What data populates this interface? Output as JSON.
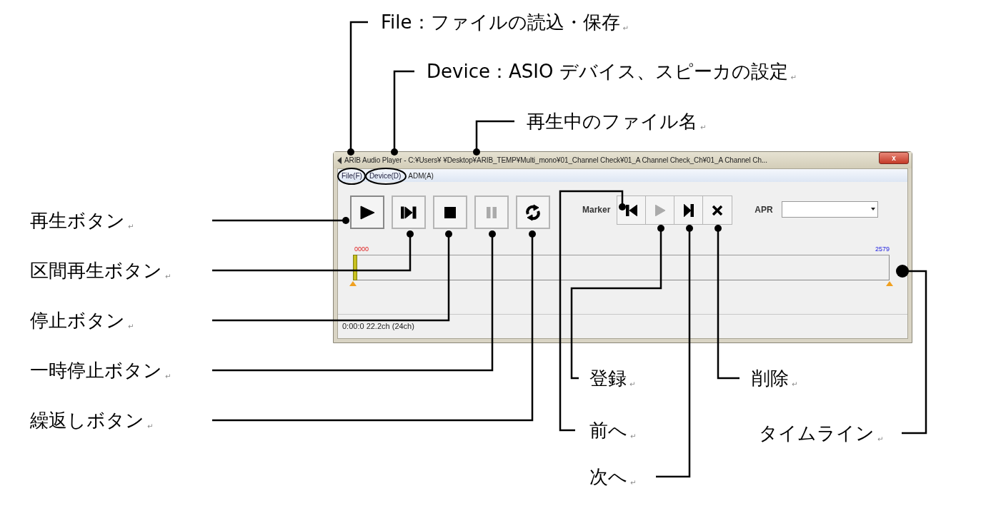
{
  "window": {
    "title": "ARIB Audio Player - C:¥Users¥ ¥Desktop¥ARIB_TEMP¥Multi_mono¥01_Channel Check¥01_A Channel Check_Ch¥01_A Channel Ch...",
    "close": "x"
  },
  "menu": [
    {
      "label": "File(F)",
      "circled": true
    },
    {
      "label": "Device(D)",
      "circled": true
    },
    {
      "label": "ADM(A)",
      "circled": false
    }
  ],
  "transport": [
    {
      "kind": "play",
      "disabled": false
    },
    {
      "kind": "skip",
      "disabled": false
    },
    {
      "kind": "stop",
      "disabled": false
    },
    {
      "kind": "pause",
      "disabled": true
    },
    {
      "kind": "repeat",
      "disabled": false
    }
  ],
  "marker": {
    "label": "Marker",
    "buttons": [
      {
        "kind": "prev",
        "disabled": false
      },
      {
        "kind": "play",
        "disabled": true
      },
      {
        "kind": "next",
        "disabled": false
      },
      {
        "kind": "delete",
        "disabled": false
      }
    ]
  },
  "apr": {
    "label": "APR"
  },
  "timeline": {
    "start": "0000",
    "end": "2579"
  },
  "status": "0:00:0 22.2ch (24ch)",
  "callouts": [
    {
      "text": "File：ファイルの読込・保存",
      "mark": "↵"
    },
    {
      "text": "Device：ASIO デバイス、スピーカの設定",
      "mark": "↵"
    },
    {
      "text": "再生中のファイル名",
      "mark": "↵"
    },
    {
      "text": "再生ボタン",
      "mark": "↵"
    },
    {
      "text": "区間再生ボタン",
      "mark": "↵"
    },
    {
      "text": "停止ボタン",
      "mark": "↵"
    },
    {
      "text": "一時停止ボタン",
      "mark": "↵"
    },
    {
      "text": "繰返しボタン",
      "mark": "↵"
    },
    {
      "text": "登録",
      "mark": "↵"
    },
    {
      "text": "前へ",
      "mark": "↵"
    },
    {
      "text": "次へ",
      "mark": "↵"
    },
    {
      "text": "削除",
      "mark": "↵"
    },
    {
      "text": "タイムライン",
      "mark": "↵"
    }
  ]
}
